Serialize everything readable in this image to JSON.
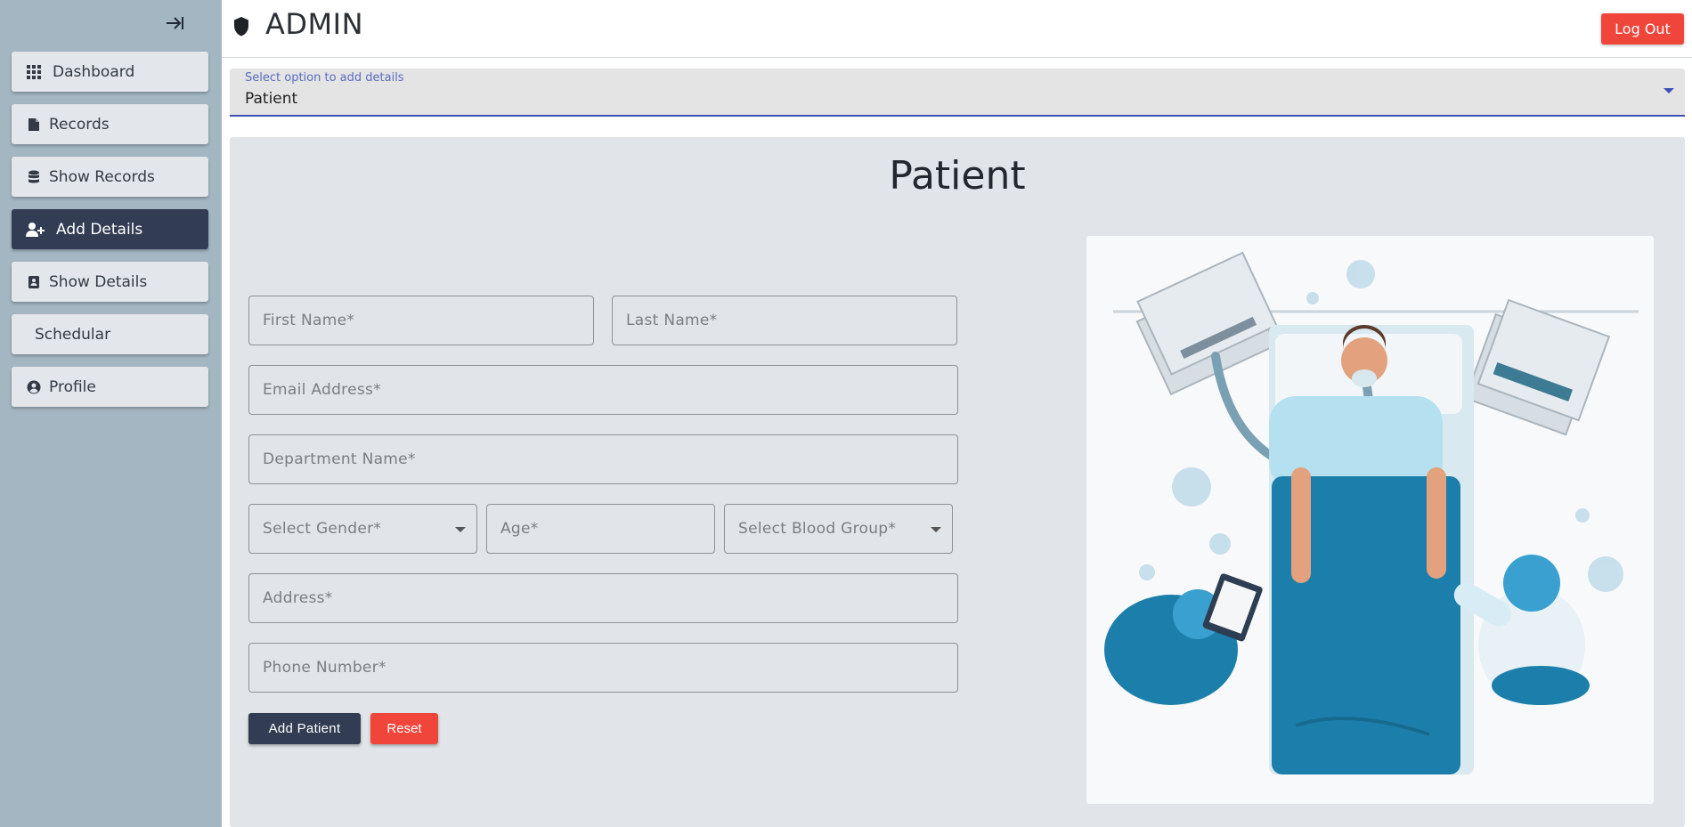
{
  "header": {
    "title": "ADMIN",
    "logout_label": "Log Out"
  },
  "sidebar": {
    "items": [
      {
        "label": "Dashboard",
        "icon": "grid-icon"
      },
      {
        "label": "Records",
        "icon": "file-icon"
      },
      {
        "label": "Show Records",
        "icon": "database-icon"
      },
      {
        "label": "Add Details",
        "icon": "user-plus-icon",
        "active": true
      },
      {
        "label": "Show Details",
        "icon": "contact-card-icon"
      },
      {
        "label": "Schedular",
        "icon": ""
      },
      {
        "label": "Profile",
        "icon": "user-circle-icon"
      }
    ]
  },
  "option_select": {
    "label": "Select option to add details",
    "value": "Patient"
  },
  "form": {
    "title": "Patient",
    "first_name": "First Name*",
    "last_name": "Last Name*",
    "email": "Email Address*",
    "department": "Department Name*",
    "gender": "Select Gender*",
    "age": "Age*",
    "blood_group": "Select Blood Group*",
    "address": "Address*",
    "phone": "Phone Number*",
    "submit_label": "Add Patient",
    "reset_label": "Reset"
  },
  "colors": {
    "sidebar_bg": "#a4b6c2",
    "active_nav": "#323d54",
    "danger": "#f0453a",
    "accent": "#3f51b5",
    "illustration_blue": "#1c7fab"
  }
}
